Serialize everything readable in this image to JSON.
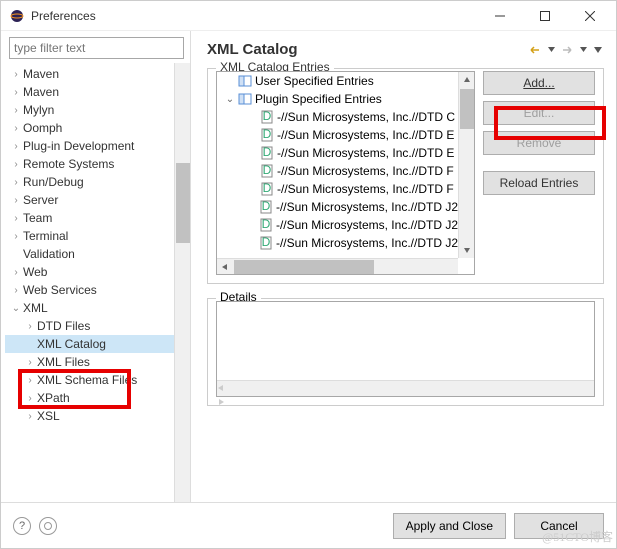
{
  "window": {
    "title": "Preferences"
  },
  "filter": {
    "placeholder": "type filter text"
  },
  "tree": {
    "items": [
      {
        "label": "Maven",
        "exp": ">",
        "depth": 1
      },
      {
        "label": "Maven",
        "exp": ">",
        "depth": 1
      },
      {
        "label": "Mylyn",
        "exp": ">",
        "depth": 1
      },
      {
        "label": "Oomph",
        "exp": ">",
        "depth": 1
      },
      {
        "label": "Plug-in Development",
        "exp": ">",
        "depth": 1
      },
      {
        "label": "Remote Systems",
        "exp": ">",
        "depth": 1
      },
      {
        "label": "Run/Debug",
        "exp": ">",
        "depth": 1
      },
      {
        "label": "Server",
        "exp": ">",
        "depth": 1
      },
      {
        "label": "Team",
        "exp": ">",
        "depth": 1
      },
      {
        "label": "Terminal",
        "exp": ">",
        "depth": 1
      },
      {
        "label": "Validation",
        "exp": "",
        "depth": 1
      },
      {
        "label": "Web",
        "exp": ">",
        "depth": 1
      },
      {
        "label": "Web Services",
        "exp": ">",
        "depth": 1
      },
      {
        "label": "XML",
        "exp": "v",
        "depth": 1
      },
      {
        "label": "DTD Files",
        "exp": ">",
        "depth": 2
      },
      {
        "label": "XML Catalog",
        "exp": "",
        "depth": 2,
        "selected": true
      },
      {
        "label": "XML Files",
        "exp": ">",
        "depth": 2
      },
      {
        "label": "XML Schema Files",
        "exp": ">",
        "depth": 2
      },
      {
        "label": "XPath",
        "exp": ">",
        "depth": 2
      },
      {
        "label": "XSL",
        "exp": ">",
        "depth": 2
      }
    ]
  },
  "panel": {
    "title": "XML Catalog"
  },
  "entries": {
    "legend": "XML Catalog Entries",
    "items": [
      {
        "exp": "",
        "icon": "book",
        "label": "User Specified Entries",
        "depth": 1
      },
      {
        "exp": "v",
        "icon": "book",
        "label": "Plugin Specified Entries",
        "depth": 1
      },
      {
        "exp": "",
        "icon": "dtd",
        "label": "-//Sun Microsystems, Inc.//DTD C",
        "depth": 2
      },
      {
        "exp": "",
        "icon": "dtd",
        "label": "-//Sun Microsystems, Inc.//DTD E",
        "depth": 2
      },
      {
        "exp": "",
        "icon": "dtd",
        "label": "-//Sun Microsystems, Inc.//DTD E",
        "depth": 2
      },
      {
        "exp": "",
        "icon": "dtd",
        "label": "-//Sun Microsystems, Inc.//DTD F",
        "depth": 2
      },
      {
        "exp": "",
        "icon": "dtd",
        "label": "-//Sun Microsystems, Inc.//DTD F",
        "depth": 2
      },
      {
        "exp": "",
        "icon": "dtd",
        "label": "-//Sun Microsystems, Inc.//DTD J2",
        "depth": 2
      },
      {
        "exp": "",
        "icon": "dtd",
        "label": "-//Sun Microsystems, Inc.//DTD J2",
        "depth": 2
      },
      {
        "exp": "",
        "icon": "dtd",
        "label": "-//Sun Microsystems, Inc.//DTD J2",
        "depth": 2
      }
    ]
  },
  "buttons": {
    "add": "Add...",
    "edit": "Edit...",
    "remove": "Remove",
    "reload": "Reload Entries"
  },
  "details": {
    "legend": "Details"
  },
  "footer": {
    "apply": "Apply and Close",
    "cancel": "Cancel"
  },
  "watermark": "@51CTO博客"
}
